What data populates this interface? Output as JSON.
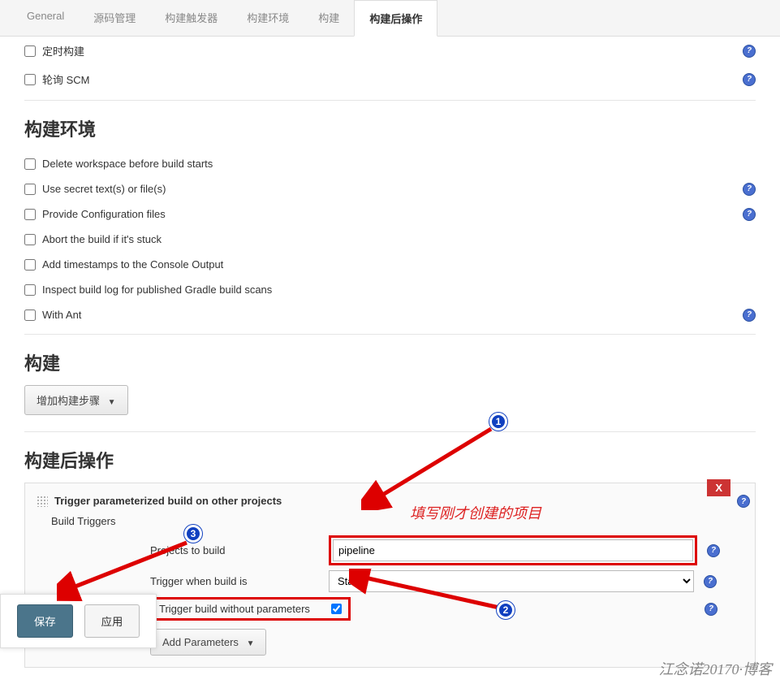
{
  "tabs": {
    "general": "General",
    "scm": "源码管理",
    "triggers": "构建触发器",
    "env": "构建环境",
    "build": "构建",
    "post": "构建后操作"
  },
  "trigger_checks": {
    "timed": "定时构建",
    "poll_scm": "轮询 SCM"
  },
  "sections": {
    "build_env": "构建环境",
    "build": "构建",
    "post_build": "构建后操作"
  },
  "env_checks": {
    "delete_ws": "Delete workspace before build starts",
    "secret": "Use secret text(s) or file(s)",
    "config_files": "Provide Configuration files",
    "abort_stuck": "Abort the build if it's stuck",
    "timestamps": "Add timestamps to the Console Output",
    "gradle_scan": "Inspect build log for published Gradle build scans",
    "with_ant": "With Ant"
  },
  "buttons": {
    "add_build_step": "增加构建步骤",
    "add_parameters": "Add Parameters",
    "save": "保存",
    "apply": "应用",
    "close_x": "X"
  },
  "panel": {
    "title": "Trigger parameterized build on other projects",
    "build_triggers": "Build Triggers",
    "projects_to_build": "Projects to build",
    "projects_value": "pipeline",
    "trigger_when": "Trigger when build is",
    "trigger_when_value": "Stable",
    "trigger_without_params": "Trigger build without parameters"
  },
  "annotations": {
    "fill_project": "填写刚才创建的项目",
    "callout1": "1",
    "callout2": "2",
    "callout3": "3"
  },
  "watermark": "江念诺20170·博客"
}
